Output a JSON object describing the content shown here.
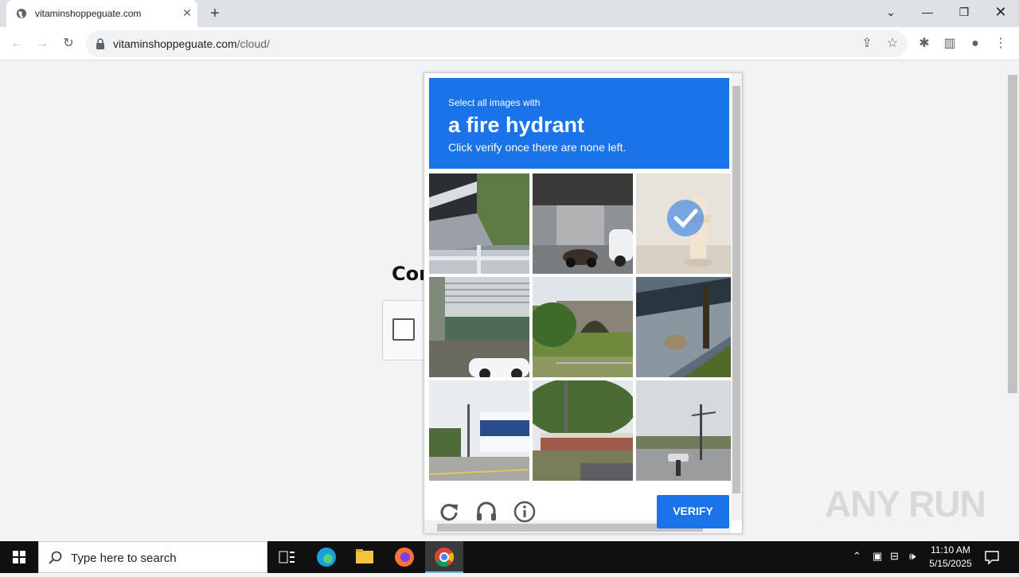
{
  "browser": {
    "tab_title": "vitaminshoppeguate.com",
    "url_host": "vitaminshoppeguate.com",
    "url_path": "/cloud/"
  },
  "page": {
    "heading_partial": "Cor"
  },
  "captcha": {
    "instruction_top": "Select all images with",
    "target": "a fire hydrant",
    "instruction_bottom": "Click verify once there are none left.",
    "verify_label": "VERIFY",
    "tiles": [
      {
        "scene": "stairs-railing",
        "selected": false
      },
      {
        "scene": "scooter-building",
        "selected": false
      },
      {
        "scene": "fire-hydrant",
        "selected": true
      },
      {
        "scene": "building-car",
        "selected": false
      },
      {
        "scene": "stone-bridge",
        "selected": false
      },
      {
        "scene": "curb-grass",
        "selected": false
      },
      {
        "scene": "streetlight-building",
        "selected": false
      },
      {
        "scene": "fence-trees",
        "selected": false
      },
      {
        "scene": "intersection",
        "selected": false
      }
    ]
  },
  "watermark": "ANY RUN",
  "taskbar": {
    "search_placeholder": "Type here to search",
    "time": "11:10 AM",
    "date": "5/15/2025"
  },
  "colors": {
    "accent": "#1a73e8"
  }
}
